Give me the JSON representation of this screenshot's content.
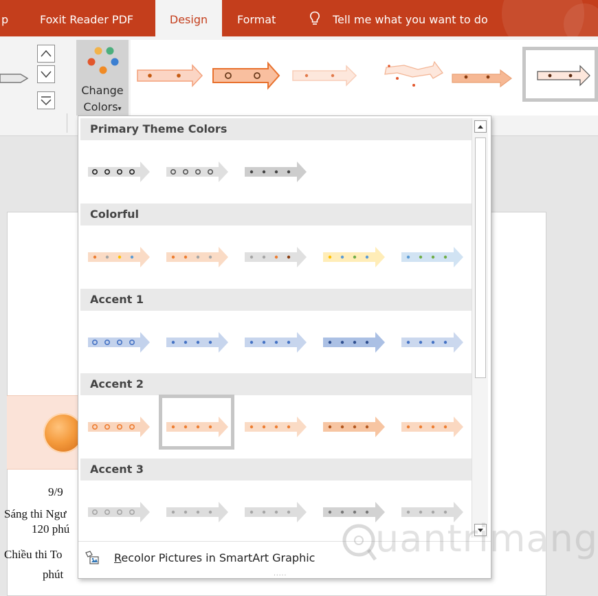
{
  "tabs": [
    {
      "label": "p"
    },
    {
      "label": "Foxit Reader PDF"
    },
    {
      "label": "Design"
    },
    {
      "label": "Format"
    }
  ],
  "tell_me": "Tell me what you want to do",
  "ribbon": {
    "change_colors_label_1": "Change",
    "change_colors_label_2": "Colors",
    "dropdown_caret": "▾"
  },
  "dropdown": {
    "sections": [
      {
        "title": "Primary Theme Colors"
      },
      {
        "title": "Colorful"
      },
      {
        "title": "Accent 1"
      },
      {
        "title": "Accent 2"
      },
      {
        "title": "Accent 3"
      }
    ],
    "selected": "Accent 2, option 2",
    "recolor_label": "Recolor Pictures in SmartArt Graphic",
    "recolor_accesskey": "R",
    "grip": "....."
  },
  "document": {
    "date": "9/9",
    "line1": "Sáng thi Ngư",
    "line2": "120 phú",
    "line3": "Chiều thi To",
    "line4": "phút"
  },
  "watermark": "uantrimang",
  "colors": {
    "ribbon_red": "#c43e1c",
    "primary_dark": "#4d4d4d",
    "accent1": "#4472c4",
    "accent2": "#ed7d31",
    "accent3": "#a5a5a5",
    "colorful": [
      "#ed7d31",
      "#a5a5a5",
      "#ffc000",
      "#5b9bd5",
      "#70ad47"
    ]
  }
}
